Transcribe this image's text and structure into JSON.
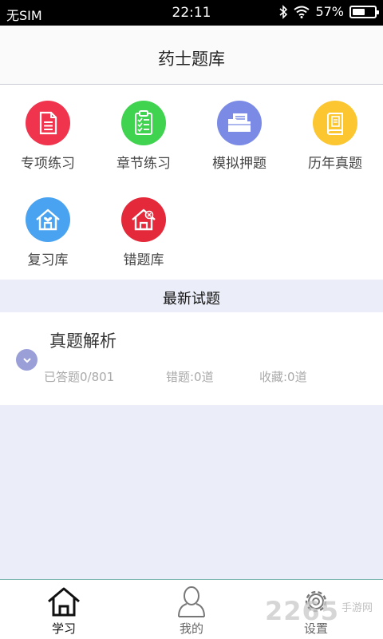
{
  "status_bar": {
    "carrier": "无SIM",
    "time": "22:11",
    "battery_pct": "57%",
    "battery_level": 0.57
  },
  "header": {
    "title": "药士题库"
  },
  "grid": [
    {
      "label": "专项练习",
      "icon": "document-icon",
      "color": "#f0344e"
    },
    {
      "label": "章节练习",
      "icon": "clipboard-checklist-icon",
      "color": "#3fd34f"
    },
    {
      "label": "模拟押题",
      "icon": "folder-icon",
      "color": "#7b8be5"
    },
    {
      "label": "历年真题",
      "icon": "book-icon",
      "color": "#fbc62f"
    },
    {
      "label": "复习库",
      "icon": "house-heart-icon",
      "color": "#4aa3f0"
    },
    {
      "label": "错题库",
      "icon": "house-x-icon",
      "color": "#e4293a"
    }
  ],
  "section": {
    "title": "最新试题"
  },
  "card": {
    "name": "真题解析",
    "answered": "已答题0/801",
    "wrong": "错题:0道",
    "favorites": "收藏:0道"
  },
  "tabs": [
    {
      "label": "学习",
      "icon": "home-icon",
      "active": true
    },
    {
      "label": "我的",
      "icon": "user-icon",
      "active": false
    },
    {
      "label": "设置",
      "icon": "gear-icon",
      "active": false
    }
  ],
  "watermark": {
    "text": "2265",
    "sub": "手游网"
  }
}
